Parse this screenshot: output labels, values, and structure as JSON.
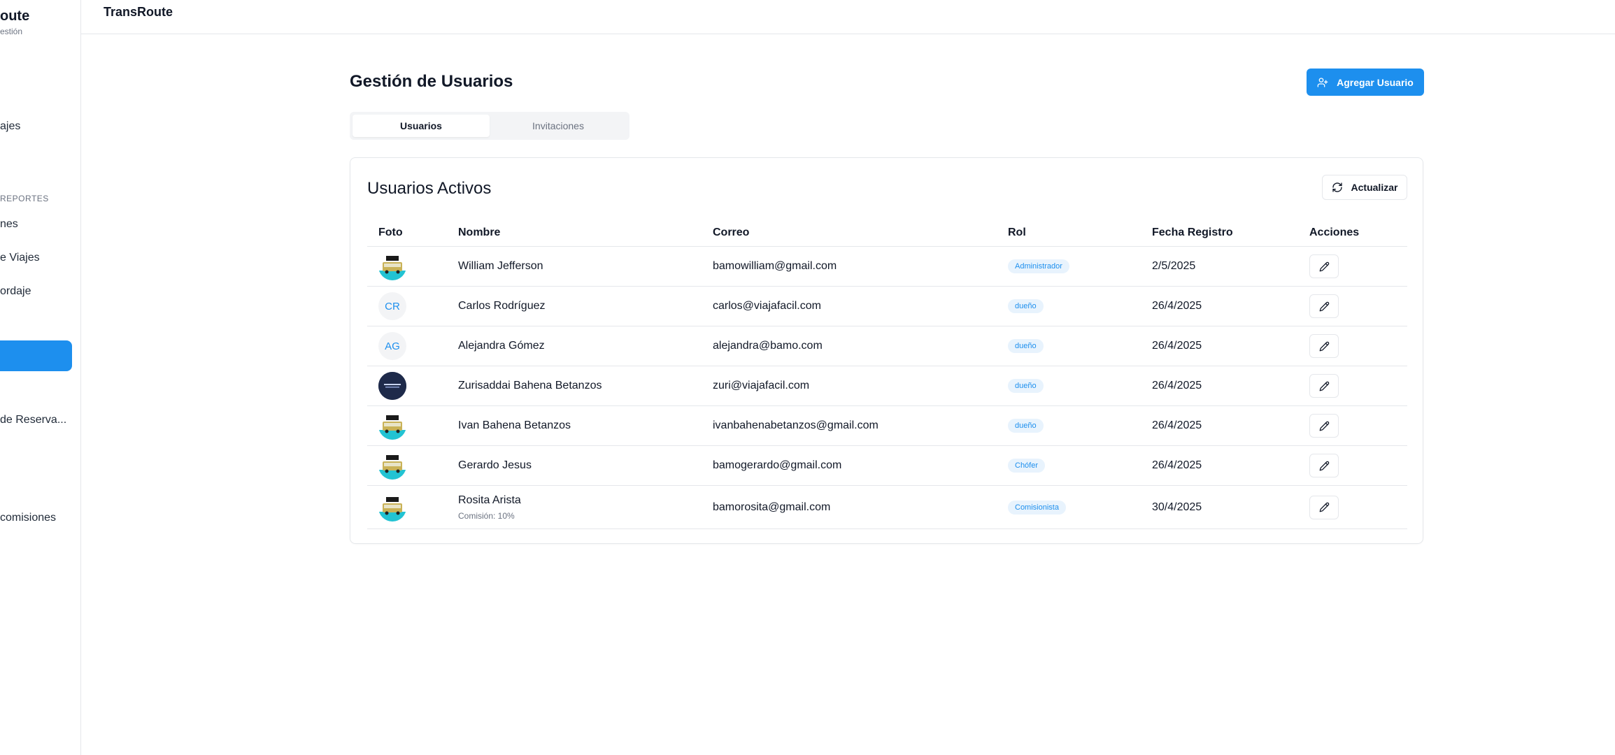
{
  "sidebar": {
    "brand_title": "oute",
    "brand_subtitle": "estión",
    "section_label": "REPORTES",
    "items": [
      {
        "label": "ajes"
      },
      {
        "label": "nes"
      },
      {
        "label": "e Viajes"
      },
      {
        "label": "ordaje"
      },
      {
        "label": ""
      },
      {
        "label": "de Reserva..."
      },
      {
        "label": "comisiones"
      }
    ]
  },
  "topbar": {
    "title": "TransRoute"
  },
  "page": {
    "title": "Gestión de Usuarios",
    "add_button_label": "Agregar Usuario",
    "tabs": [
      {
        "label": "Usuarios",
        "active": true
      },
      {
        "label": "Invitaciones",
        "active": false
      }
    ]
  },
  "card": {
    "title": "Usuarios Activos",
    "refresh_label": "Actualizar",
    "columns": [
      "Foto",
      "Nombre",
      "Correo",
      "Rol",
      "Fecha Registro",
      "Acciones"
    ],
    "rows": [
      {
        "photo": "bamo-logo",
        "initials": "",
        "name": "William Jefferson",
        "subtext": "",
        "email": "bamowilliam@gmail.com",
        "role": "Administrador",
        "date": "2/5/2025"
      },
      {
        "photo": "initials",
        "initials": "CR",
        "name": "Carlos Rodríguez",
        "subtext": "",
        "email": "carlos@viajafacil.com",
        "role": "dueño",
        "date": "26/4/2025"
      },
      {
        "photo": "initials",
        "initials": "AG",
        "name": "Alejandra Gómez",
        "subtext": "",
        "email": "alejandra@bamo.com",
        "role": "dueño",
        "date": "26/4/2025"
      },
      {
        "photo": "dark-logo",
        "initials": "",
        "name": "Zurisaddai Bahena Betanzos",
        "subtext": "",
        "email": "zuri@viajafacil.com",
        "role": "dueño",
        "date": "26/4/2025"
      },
      {
        "photo": "bamo-logo",
        "initials": "",
        "name": "Ivan Bahena Betanzos",
        "subtext": "",
        "email": "ivanbahenabetanzos@gmail.com",
        "role": "dueño",
        "date": "26/4/2025"
      },
      {
        "photo": "bamo-logo",
        "initials": "",
        "name": "Gerardo Jesus",
        "subtext": "",
        "email": "bamogerardo@gmail.com",
        "role": "Chófer",
        "date": "26/4/2025"
      },
      {
        "photo": "bamo-logo",
        "initials": "",
        "name": "Rosita Arista",
        "subtext": "Comisión: 10%",
        "email": "bamorosita@gmail.com",
        "role": "Comisionista",
        "date": "30/4/2025"
      }
    ]
  },
  "colors": {
    "accent": "#1d8fee",
    "badge_bg": "#e8f3fd",
    "border": "#e5e7eb"
  },
  "icons": {
    "add_user": "user-plus-icon",
    "refresh": "refresh-icon",
    "edit": "pencil-icon"
  }
}
